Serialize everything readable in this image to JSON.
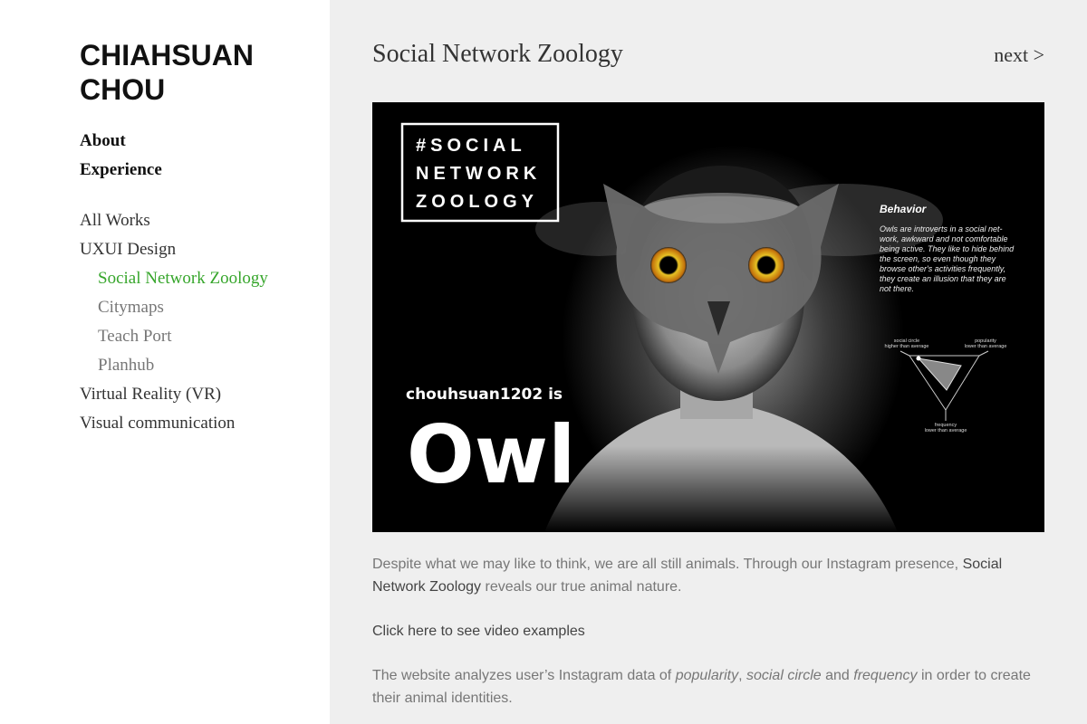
{
  "logo": {
    "line1": "CHIAHSUAN",
    "line2": "CHOU"
  },
  "nav": {
    "about": "About",
    "experience": "Experience",
    "all_works": "All Works",
    "uxui": "UXUI Design",
    "sub": [
      "Social Network Zoology",
      "Citymaps",
      "Teach Port",
      "Planhub"
    ],
    "vr": "Virtual Reality (VR)",
    "visual": "Visual communication"
  },
  "page": {
    "title": "Social Network Zoology",
    "next": "next >"
  },
  "hero": {
    "badge": [
      "#SOCIAL",
      "NETWORK",
      "ZOOLOGY"
    ],
    "user_line": "chouhsuan1202 is",
    "animal": "Owl",
    "behavior_title": "Behavior",
    "behavior_lines": [
      "Owls are introverts in a social net-",
      "work, awkward and not comfortable",
      "being active. They like to hide behind",
      "the screen, so even though they",
      "browse other's activities frequently,",
      "they create an illusion  that they are",
      "not there."
    ],
    "radar": {
      "social_circle": [
        "social circle",
        "higher than average"
      ],
      "popularity": [
        "popularity",
        "lower than average"
      ],
      "frequency": [
        "frequency",
        "lower than average"
      ]
    }
  },
  "content": {
    "p1_a": "Despite what we may like to think, we are all still animals. Through our Instagram presence, ",
    "p1_b": "Social Network Zoology",
    "p1_c": " reveals our true animal nature.",
    "link": "Click here to see video examples",
    "p3_a": "The website analyzes user’s Instagram data of ",
    "p3_pop": "popularity",
    "p3_comma": ", ",
    "p3_sc": "social circle",
    "p3_and": " and ",
    "p3_freq": "frequency",
    "p3_b": " in order to create their animal identities."
  },
  "colors": {
    "accent": "#37a62c",
    "sidebar_bg": "#ffffff",
    "main_bg": "#efefef"
  }
}
